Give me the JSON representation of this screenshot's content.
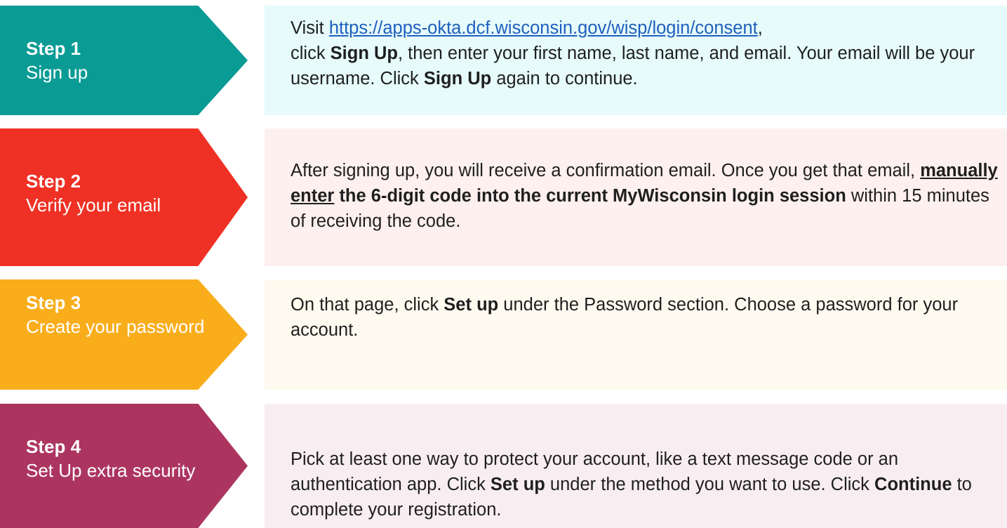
{
  "steps": [
    {
      "step": "Step 1",
      "title": "Sign up",
      "color": "#099b94",
      "panel_color": "#e6fbfa",
      "body": {
        "p1": "Visit ",
        "link": "https://apps-okta.dcf.wisconsin.gov/wisp/login/consent",
        "p2": ",",
        "p3": "click ",
        "b1": "Sign Up",
        "p4": ", then enter your first name, last name, and email. Your email will be your username. Click ",
        "b2": "Sign Up",
        "p5": " again to continue."
      }
    },
    {
      "step": "Step 2",
      "title": "Verify your email",
      "color": "#ee3124",
      "panel_color": "#fdf0ef",
      "body": {
        "p1": "After signing up, you will receive a confirmation email. Once you get that email, ",
        "u1": "manually enter",
        "b1": " the 6-digit code into the current MyWisconsin login session",
        "p2": " within 15 minutes of receiving the code."
      }
    },
    {
      "step": "Step 3",
      "title": "Create your password",
      "color": "#f9ad1b",
      "panel_color": "#fefaef",
      "body": {
        "p1": "On that page, click ",
        "b1": "Set up",
        "p2": " under the Password section. Choose a password for your account."
      }
    },
    {
      "step": "Step 4",
      "title": "Set Up extra security",
      "color": "#ac3560",
      "panel_color": "#f8eef1",
      "body": {
        "p1": "Pick at least one way to protect your account, like a text message code or an authentication app. Click ",
        "b1": "Set up",
        "p2": " under the method you want to use. Click ",
        "b2": "Continue",
        "p3": " to complete your registration."
      }
    }
  ]
}
